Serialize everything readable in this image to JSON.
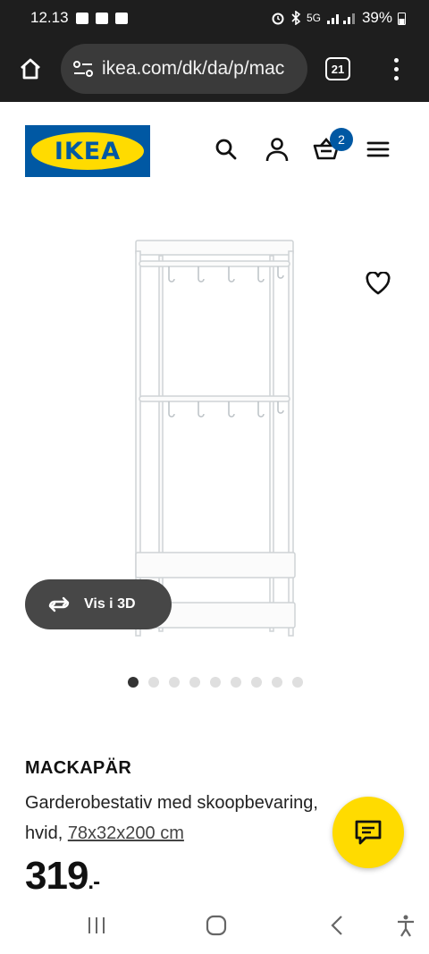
{
  "status_bar": {
    "time": "12.13",
    "network": "5G",
    "battery": "39%"
  },
  "browser": {
    "url": "ikea.com/dk/da/p/mac",
    "tab_count": "21"
  },
  "header": {
    "logo_text": "IKEA",
    "cart_count": "2",
    "colors": {
      "brand_blue": "#0058a3",
      "brand_yellow": "#ffdb00"
    }
  },
  "product_image": {
    "view_3d_label": "Vis i 3D",
    "carousel_total": 9,
    "carousel_active": 0
  },
  "product": {
    "name": "MACKAPÄR",
    "description": "Garderobestativ med skoopbevaring,",
    "description_color": "hvid,",
    "size": "78x32x200 cm",
    "price": "319",
    "price_suffix": ".-"
  },
  "icons": [
    "home-icon",
    "tune-icon",
    "tabs-icon",
    "more-icon",
    "search-icon",
    "user-icon",
    "cart-icon",
    "hamburger-icon",
    "heart-icon",
    "rotate-3d-icon",
    "chat-icon",
    "recent-apps-icon",
    "home-nav-icon",
    "back-icon",
    "accessibility-icon"
  ]
}
